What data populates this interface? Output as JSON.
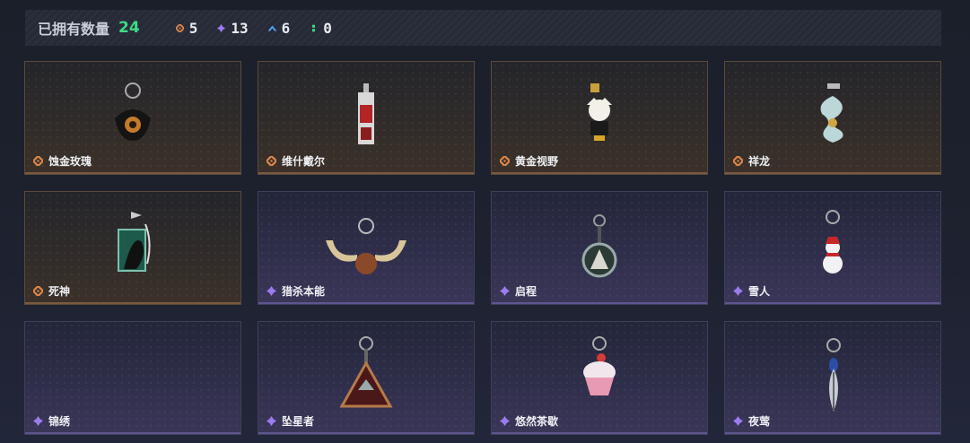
{
  "header": {
    "title": "已拥有数量",
    "total": "24",
    "counts": [
      {
        "tier": "orange",
        "value": "5",
        "color": "#e0874a"
      },
      {
        "tier": "purple",
        "value": "13",
        "color": "#9b7cf0"
      },
      {
        "tier": "blue",
        "value": "6",
        "color": "#4aa3f0"
      },
      {
        "tier": "green",
        "value": "0",
        "color": "#3ddc84"
      }
    ]
  },
  "items": [
    {
      "name": "蚀金玫瑰",
      "tier": "orange",
      "icon": "teapot-charm-icon"
    },
    {
      "name": "维什戴尔",
      "tier": "orange",
      "icon": "card-charm-icon"
    },
    {
      "name": "黄金视野",
      "tier": "orange",
      "icon": "figure-charm-icon"
    },
    {
      "name": "祥龙",
      "tier": "orange",
      "icon": "dragon-charm-icon"
    },
    {
      "name": "死神",
      "tier": "orange",
      "icon": "reaper-charm-icon"
    },
    {
      "name": "猎杀本能",
      "tier": "purple",
      "icon": "antler-charm-icon"
    },
    {
      "name": "启程",
      "tier": "purple",
      "icon": "medal-charm-icon"
    },
    {
      "name": "雪人",
      "tier": "purple",
      "icon": "snowman-charm-icon"
    },
    {
      "name": "锦绣",
      "tier": "purple",
      "icon": "empty-charm-icon"
    },
    {
      "name": "坠星者",
      "tier": "purple",
      "icon": "triangle-charm-icon"
    },
    {
      "name": "悠然茶歇",
      "tier": "purple",
      "icon": "cupcake-charm-icon"
    },
    {
      "name": "夜莺",
      "tier": "purple",
      "icon": "feather-charm-icon"
    }
  ],
  "colors": {
    "orange": "#e0874a",
    "purple": "#9b7cf0",
    "blue": "#4aa3f0",
    "green": "#3ddc84"
  }
}
